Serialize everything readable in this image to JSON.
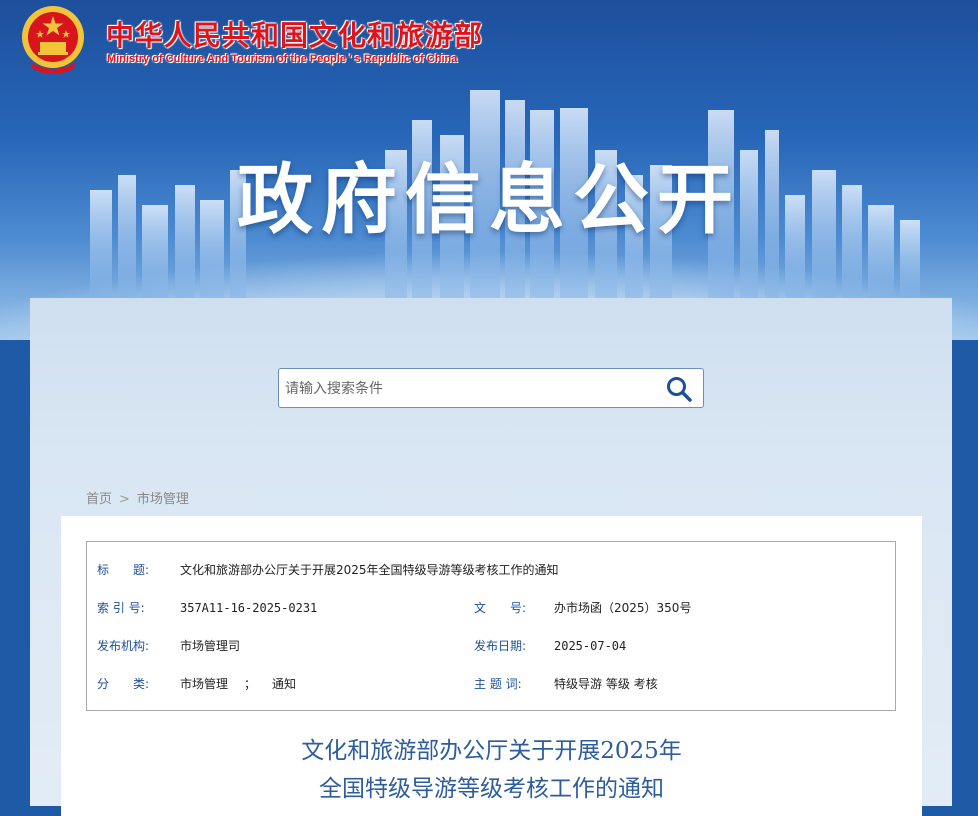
{
  "header": {
    "ministry_cn": "中华人民共和国文化和旅游部",
    "ministry_en": "Ministry of Culture And Tourism of the People ' s Republic of China",
    "section_title": "政府信息公开",
    "emblem_icon": "national-emblem-icon"
  },
  "search": {
    "placeholder": "请输入搜索条件",
    "icon": "search-icon"
  },
  "breadcrumb": {
    "home": "首页",
    "separator": ">",
    "current": "市场管理"
  },
  "meta": {
    "title_label": "标　　题:",
    "title_value": "文化和旅游部办公厅关于开展2025年全国特级导游等级考核工作的通知",
    "index_label": "索 引 号:",
    "index_value": "357A11-16-2025-0231",
    "docno_label": "文　　号:",
    "docno_value": "办市场函（2025）350号",
    "issuer_label": "发布机构:",
    "issuer_value": "市场管理司",
    "date_label": "发布日期:",
    "date_value": "2025-07-04",
    "category_label": "分　　类:",
    "category_value_1": "市场管理",
    "category_separator": "；",
    "category_value_2": "通知",
    "keywords_label": "主 题 词:",
    "keywords_value": "特级导游 等级 考核"
  },
  "document": {
    "title_line1": "文化和旅游部办公厅关于开展2025年",
    "title_line2": "全国特级导游等级考核工作的通知"
  },
  "colors": {
    "brand_red": "#e0131b",
    "brand_blue": "#1d4f9c",
    "title_blue": "#2d5d9c"
  }
}
